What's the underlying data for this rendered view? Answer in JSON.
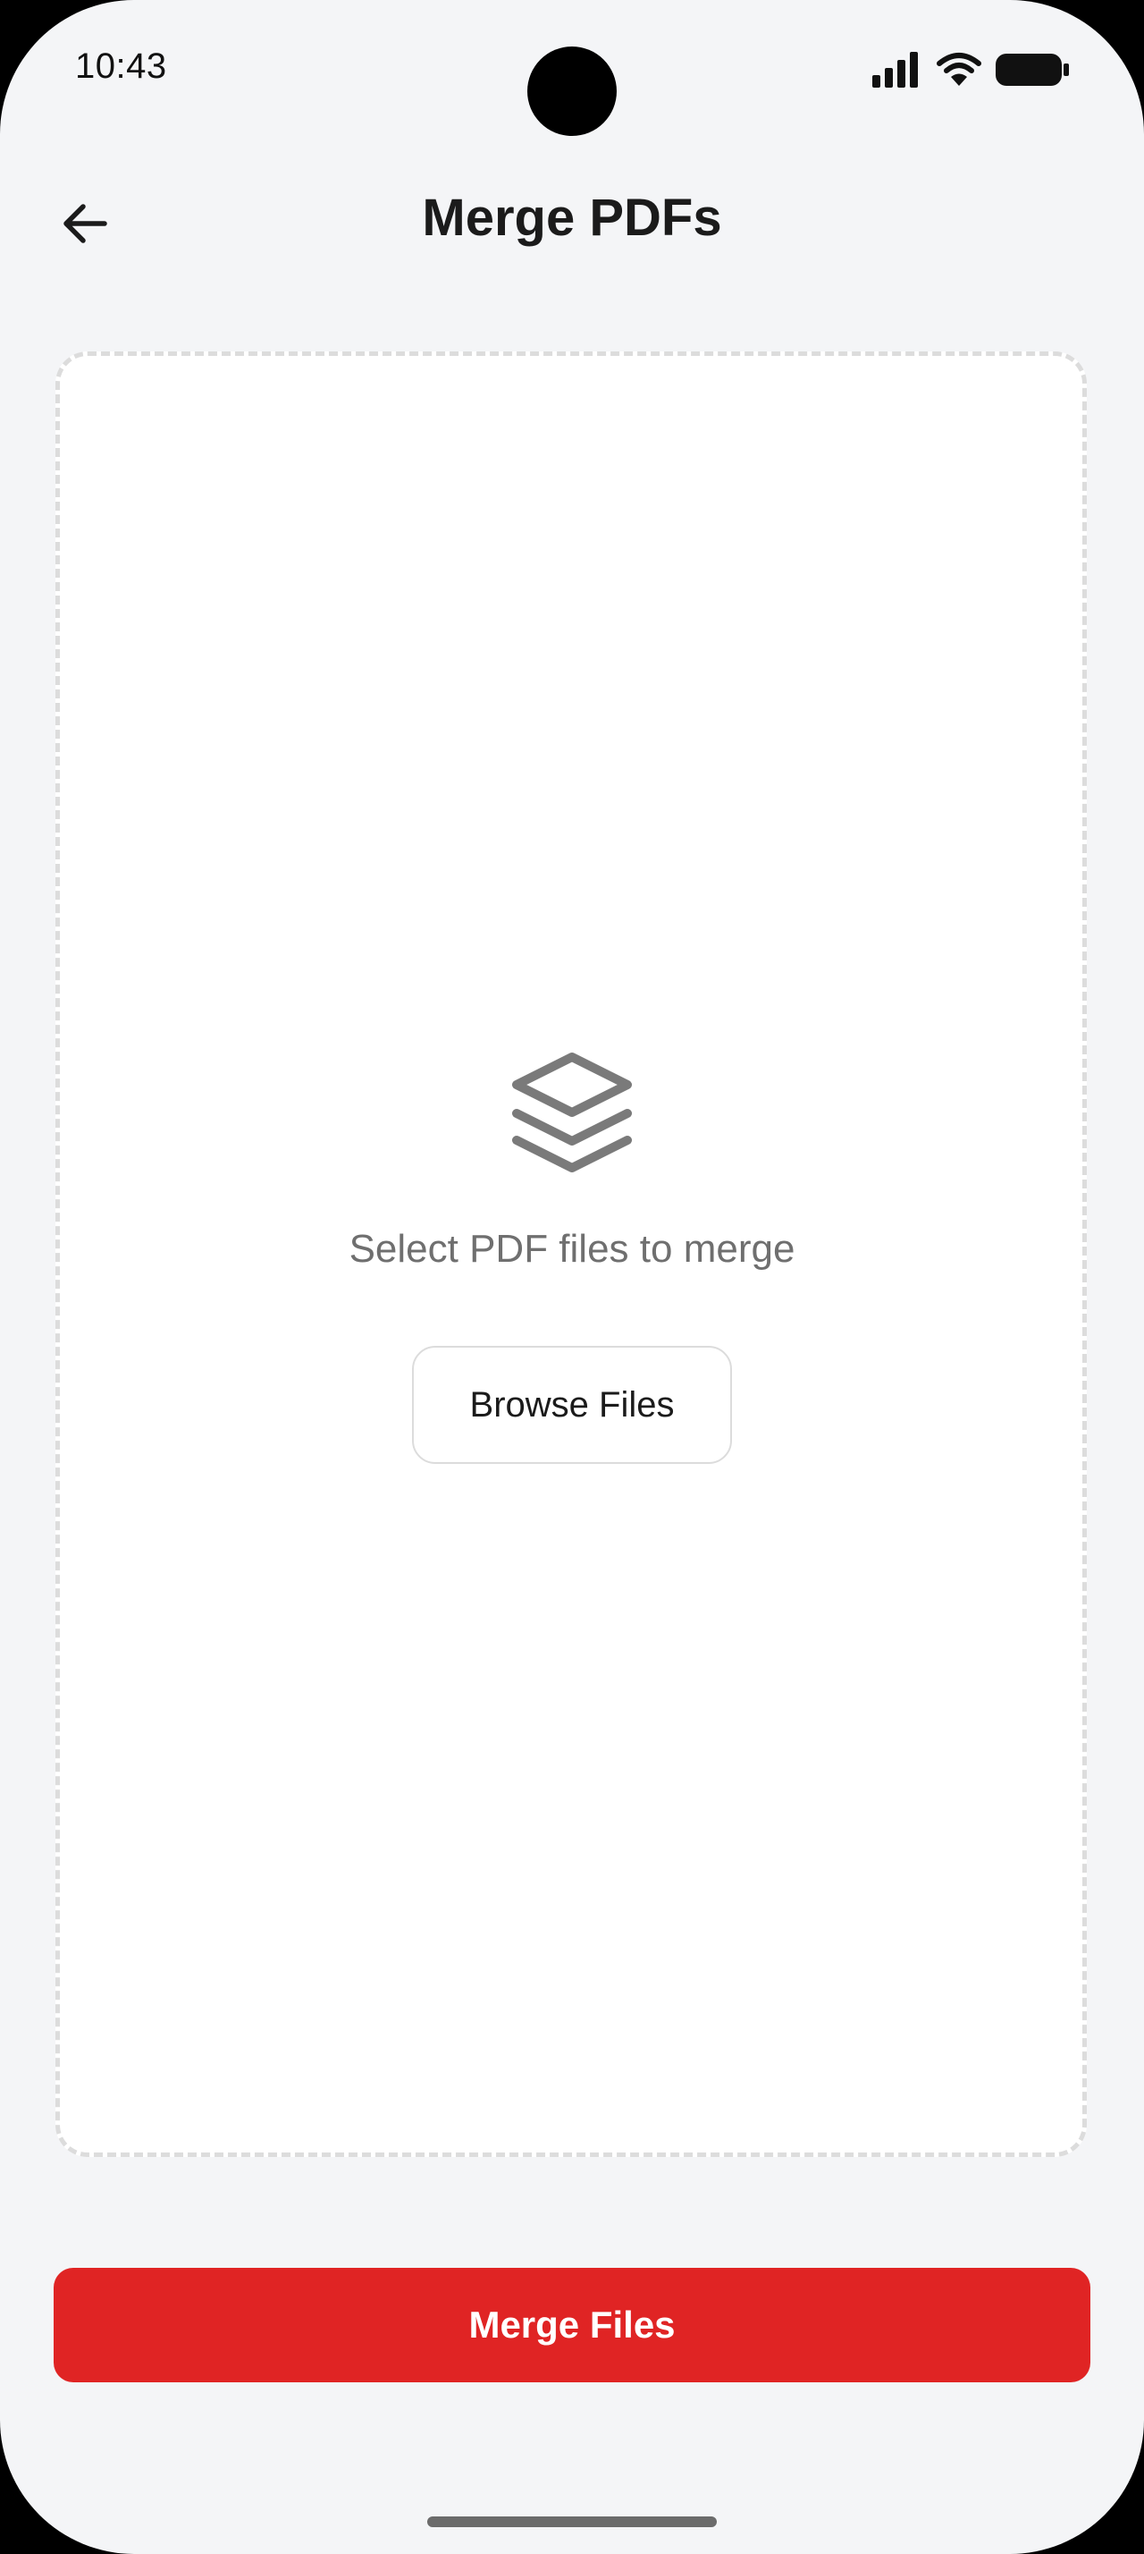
{
  "status_bar": {
    "time": "10:43",
    "icons": [
      "signal-icon",
      "wifi-icon",
      "battery-icon"
    ]
  },
  "header": {
    "title": "Merge PDFs",
    "back_icon": "arrow-left-icon"
  },
  "drop_zone": {
    "icon": "layers-icon",
    "prompt": "Select PDF files to merge",
    "browse_label": "Browse Files"
  },
  "actions": {
    "merge_label": "Merge Files"
  },
  "colors": {
    "accent": "#e02424",
    "background": "#f4f5f7",
    "card": "#ffffff",
    "muted_text": "#6f6f6f"
  }
}
